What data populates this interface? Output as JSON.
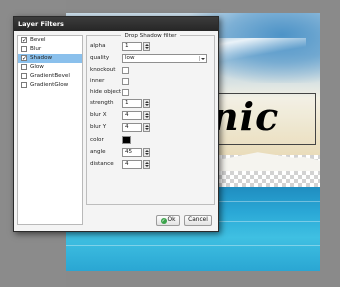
{
  "canvas": {
    "logo_fragment": "nic"
  },
  "dialog": {
    "title": "Layer Filters",
    "filters": [
      {
        "label": "Bevel",
        "checked": true,
        "selected": false
      },
      {
        "label": "Blur",
        "checked": false,
        "selected": false
      },
      {
        "label": "Shadow",
        "checked": true,
        "selected": true
      },
      {
        "label": "Glow",
        "checked": false,
        "selected": false
      },
      {
        "label": "GradientBevel",
        "checked": false,
        "selected": false
      },
      {
        "label": "GradientGlow",
        "checked": false,
        "selected": false
      }
    ],
    "panel_title": "Drop Shadow filter",
    "properties": {
      "alpha": {
        "label": "alpha",
        "value": "1"
      },
      "quality": {
        "label": "quality",
        "value": "low"
      },
      "knockout": {
        "label": "knockout",
        "checked": false
      },
      "inner": {
        "label": "inner",
        "checked": false
      },
      "hide_object": {
        "label": "hide object",
        "checked": false
      },
      "strength": {
        "label": "strength",
        "value": "1"
      },
      "blur_x": {
        "label": "blur X",
        "value": "4"
      },
      "blur_y": {
        "label": "blur Y",
        "value": "4"
      },
      "color": {
        "label": "color",
        "value": "#000000"
      },
      "angle": {
        "label": "angle",
        "value": "45"
      },
      "distance": {
        "label": "distance",
        "value": "4"
      }
    },
    "ok_label": "Ok",
    "cancel_label": "Cancel"
  },
  "colors": {
    "selection": "#8ac0ec",
    "titlebar": "#2f2f2f",
    "ok_icon": "#3aa34a"
  }
}
